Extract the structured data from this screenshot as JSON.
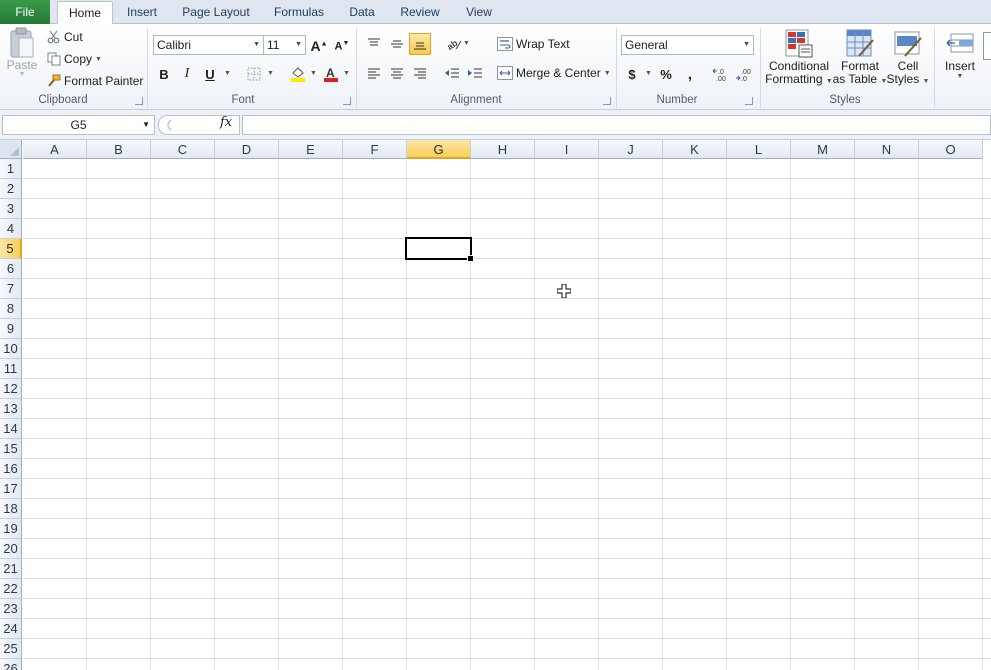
{
  "tabs": [
    {
      "label": "File"
    },
    {
      "label": "Home"
    },
    {
      "label": "Insert"
    },
    {
      "label": "Page Layout"
    },
    {
      "label": "Formulas"
    },
    {
      "label": "Data"
    },
    {
      "label": "Review"
    },
    {
      "label": "View"
    }
  ],
  "clipboard": {
    "paste": "Paste",
    "cut": "Cut",
    "copy": "Copy",
    "format_painter": "Format Painter",
    "group": "Clipboard"
  },
  "font": {
    "name": "Calibri",
    "size": "11",
    "bold": "B",
    "italic": "I",
    "underline": "U",
    "group": "Font",
    "fill_color": "#ffea00",
    "font_color": "#e02020"
  },
  "alignment": {
    "wrap_text": "Wrap Text",
    "merge_center": "Merge & Center",
    "group": "Alignment"
  },
  "number": {
    "format": "General",
    "currency": "$",
    "percent": "%",
    "comma": ",",
    "group": "Number"
  },
  "styles": {
    "conditional_1": "Conditional",
    "conditional_2": "Formatting",
    "format_table_1": "Format",
    "format_table_2": "as Table",
    "cell_styles_1": "Cell",
    "cell_styles_2": "Styles",
    "group": "Styles"
  },
  "cells_group": {
    "insert": "Insert"
  },
  "formula_bar": {
    "name_box": "G5",
    "fx": "fx",
    "content": ""
  },
  "sheet": {
    "columns": [
      "A",
      "B",
      "C",
      "D",
      "E",
      "F",
      "G",
      "H",
      "I",
      "J",
      "K",
      "L",
      "M",
      "N",
      "O"
    ],
    "rows": [
      "1",
      "2",
      "3",
      "4",
      "5",
      "6",
      "7",
      "8",
      "9",
      "10",
      "11",
      "12",
      "13",
      "14",
      "15",
      "16",
      "17",
      "18",
      "19",
      "20",
      "21",
      "22",
      "23",
      "24",
      "25",
      "26"
    ],
    "active_column": "G",
    "active_row": "5",
    "active_cell": "G5"
  }
}
